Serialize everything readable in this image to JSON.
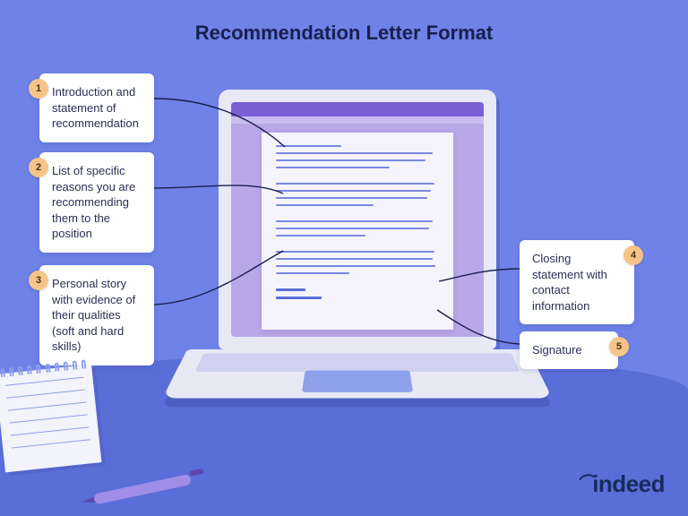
{
  "title": "Recommendation Letter Format",
  "items": [
    {
      "n": "1",
      "text": "Introduction and statement of recommendation"
    },
    {
      "n": "2",
      "text": "List of specific reasons you are recommending them to the position"
    },
    {
      "n": "3",
      "text": "Personal story with evidence of their qualities (soft and hard skills)"
    },
    {
      "n": "4",
      "text": "Closing statement with contact information"
    },
    {
      "n": "5",
      "text": "Signature"
    }
  ],
  "brand": "indeed"
}
